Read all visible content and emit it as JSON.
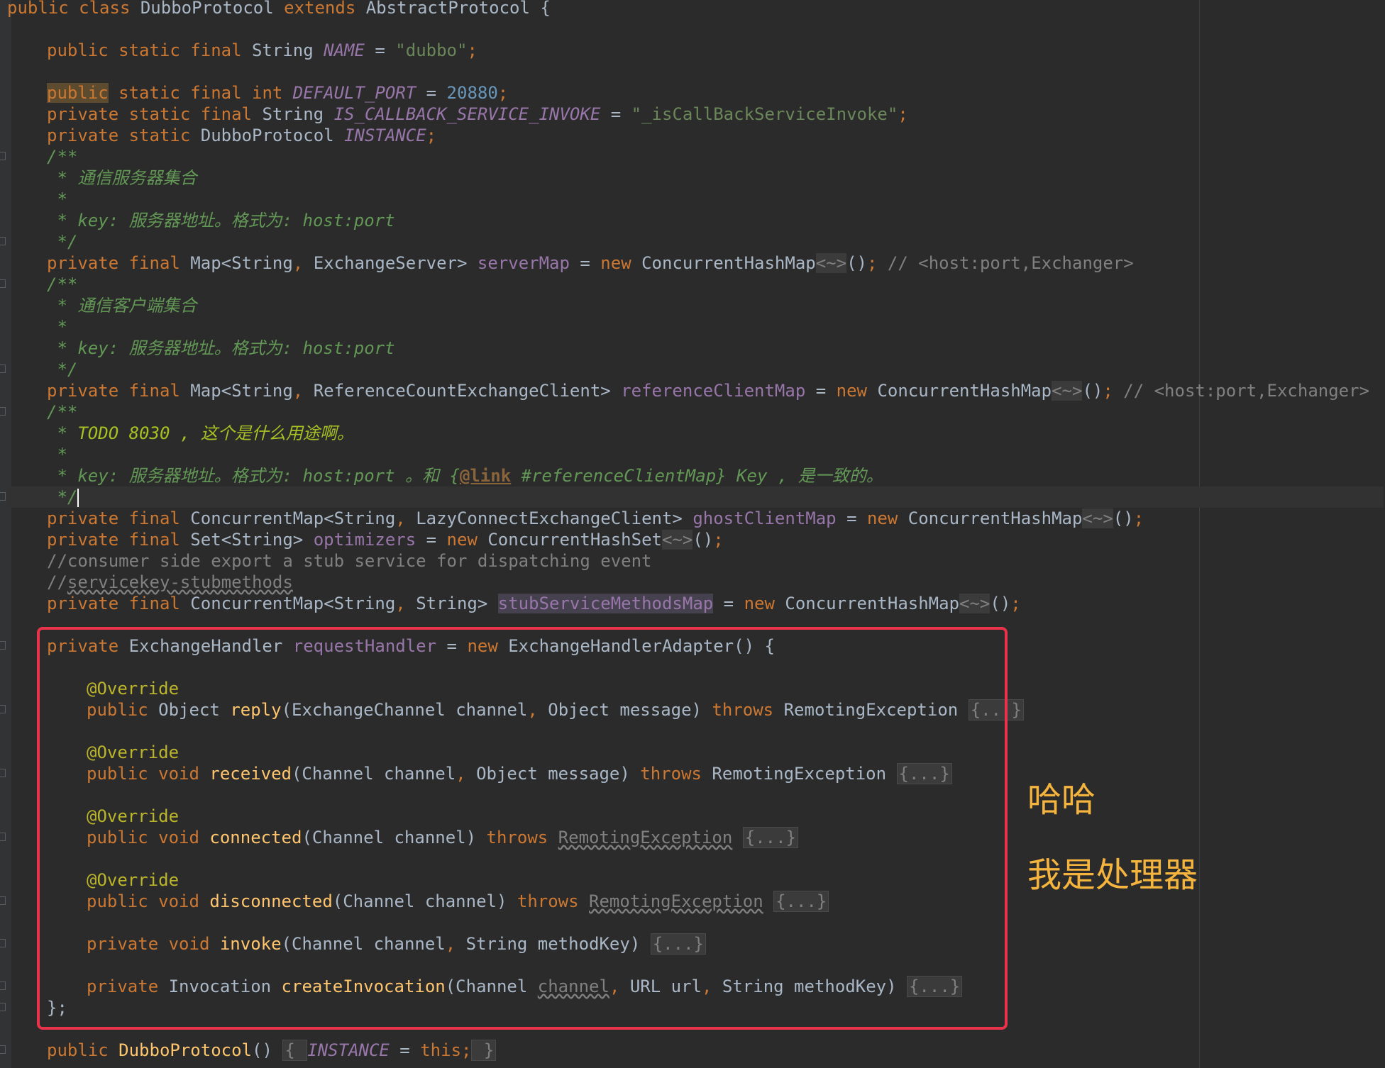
{
  "code": {
    "class_decl": {
      "p1": "public class ",
      "name": "DubboProtocol",
      "p2": " extends ",
      "super": "AbstractProtocol",
      "p3": " {"
    },
    "name_const": {
      "mods": "public static final ",
      "type": "String ",
      "name": "NAME",
      "eq": " = ",
      "value": "\"dubbo\"",
      "end": ";"
    },
    "default_port": {
      "mod1": "public",
      "mods": " static final ",
      "type": "int ",
      "name": "DEFAULT_PORT",
      "eq": " = ",
      "value": "20880",
      "end": ";"
    },
    "is_callback": {
      "mods": "private static final ",
      "type": "String ",
      "name": "IS_CALLBACK_SERVICE_INVOKE",
      "eq": " = ",
      "value": "\"_isCallBackServiceInvoke\"",
      "end": ";"
    },
    "instance": {
      "mods": "private static ",
      "type": "DubboProtocol ",
      "name": "INSTANCE",
      "end": ";"
    },
    "doc1": {
      "open": "/**",
      "line1": " * 通信服务器集合",
      "line2": " *",
      "line3_prefix": " * key: 服务器地址。格式为: ",
      "line3_code": "host:port",
      "close": " */"
    },
    "server_map": {
      "mods": "private final ",
      "type": "Map<String",
      "comma": ", ",
      "type2": "ExchangeServer> ",
      "name": "serverMap",
      "eq": " = ",
      "new": "new ",
      "ctor": "ConcurrentHashMap",
      "diamond": "<~>",
      "args": "()",
      "end": ";",
      "comment": " // <host:port,Exchanger>"
    },
    "doc2": {
      "open": "/**",
      "line1": " * 通信客户端集合",
      "line2": " *",
      "line3_prefix": " * key: 服务器地址。格式为: ",
      "line3_code": "host:port",
      "close": " */"
    },
    "reference_map": {
      "mods": "private final ",
      "type": "Map<String",
      "comma": ", ",
      "type2": "ReferenceCountExchangeClient> ",
      "name": "referenceClientMap",
      "eq": " = ",
      "new": "new ",
      "ctor": "ConcurrentHashMap",
      "diamond": "<~>",
      "args": "()",
      "end": ";",
      "comment": " // <host:port,Exchanger>"
    },
    "doc3": {
      "open": "/**",
      "line1_star": " * ",
      "line1_todo": "TODO 8030 , 这个是什么用途啊。",
      "line2": " *",
      "line3_prefix": " * key: 服务器地址。格式为: ",
      "line3_code": "host:port",
      "line3_mid": " 。和 {",
      "line3_link": "@link",
      "line3_ref": " #referenceClientMap}",
      "line3_end": " Key , 是一致的。",
      "close": " */"
    },
    "ghost_map": {
      "mods": "private final ",
      "type": "ConcurrentMap<String",
      "comma": ", ",
      "type2": "LazyConnectExchangeClient> ",
      "name": "ghostClientMap",
      "eq": " = ",
      "new": "new ",
      "ctor": "ConcurrentHashMap",
      "diamond": "<~>",
      "args": "()",
      "end": ";"
    },
    "optimizers": {
      "mods": "private final ",
      "type": "Set<String> ",
      "name": "optimizers",
      "eq": " = ",
      "new": "new ",
      "ctor": "ConcurrentHashSet",
      "diamond": "<~>",
      "args": "()",
      "end": ";"
    },
    "comment1": "//consumer side export a stub service for dispatching event",
    "comment2_prefix": "//",
    "comment2_text": "servicekey-stubmethods",
    "stub_map": {
      "mods": "private final ",
      "type": "ConcurrentMap<String",
      "comma": ", ",
      "type2": "String> ",
      "name": "stubServiceMethodsMap",
      "eq": " = ",
      "new": "new ",
      "ctor": "ConcurrentHashMap",
      "diamond": "<~>",
      "args": "()",
      "end": ";"
    },
    "handler": {
      "mods": "private ",
      "type": "ExchangeHandler ",
      "name": "requestHandler",
      "eq": " = ",
      "new": "new ",
      "ctor": "ExchangeHandlerAdapter",
      "args": "() {"
    },
    "override": "@Override",
    "reply": {
      "mods": "public ",
      "ret": "Object ",
      "name": "reply",
      "params1": "(ExchangeChannel channel",
      "comma": ", ",
      "params2": "Object message) ",
      "throws": "throws ",
      "exc": "RemotingException ",
      "fold": "{...}"
    },
    "received": {
      "mods": "public void ",
      "name": "received",
      "params1": "(Channel channel",
      "comma": ", ",
      "params2": "Object message) ",
      "throws": "throws ",
      "exc": "RemotingException ",
      "fold": "{...}"
    },
    "connected": {
      "mods": "public void ",
      "name": "connected",
      "params": "(Channel channel) ",
      "throws": "throws ",
      "exc": "RemotingException",
      "sp": " ",
      "fold": "{...}"
    },
    "disconnected": {
      "mods": "public void ",
      "name": "disconnected",
      "params": "(Channel channel) ",
      "throws": "throws ",
      "exc": "RemotingException",
      "sp": " ",
      "fold": "{...}"
    },
    "invoke": {
      "mods": "private void ",
      "name": "invoke",
      "params1": "(Channel channel",
      "comma": ", ",
      "params2": "String methodKey) ",
      "fold": "{...}"
    },
    "create_invocation": {
      "mods": "private ",
      "ret": "Invocation ",
      "name": "createInvocation",
      "params1": "(Channel ",
      "unused": "channel",
      "comma": ", ",
      "params2": "URL url",
      "comma2": ", ",
      "params3": "String methodKey) ",
      "fold": "{...}"
    },
    "handler_end": "};",
    "ctor": {
      "mods": "public ",
      "name": "DubboProtocol",
      "args": "() ",
      "body_open": "{ ",
      "inst": "INSTANCE",
      "eq": " = ",
      "this": "this",
      "semi": ";",
      "body_close": " }"
    }
  },
  "annotations": {
    "note1": "哈哈",
    "note2": "我是处理器",
    "box_color": "#e8334a",
    "note_color": "#f5b43d"
  },
  "colors": {
    "background": "#2b2b2b",
    "keyword": "#cc7832",
    "string": "#6a8759",
    "number": "#6897bb",
    "field": "#9876aa",
    "method": "#ffc66d",
    "annotation": "#bbb529",
    "doc_comment": "#629755",
    "comment": "#808080"
  }
}
